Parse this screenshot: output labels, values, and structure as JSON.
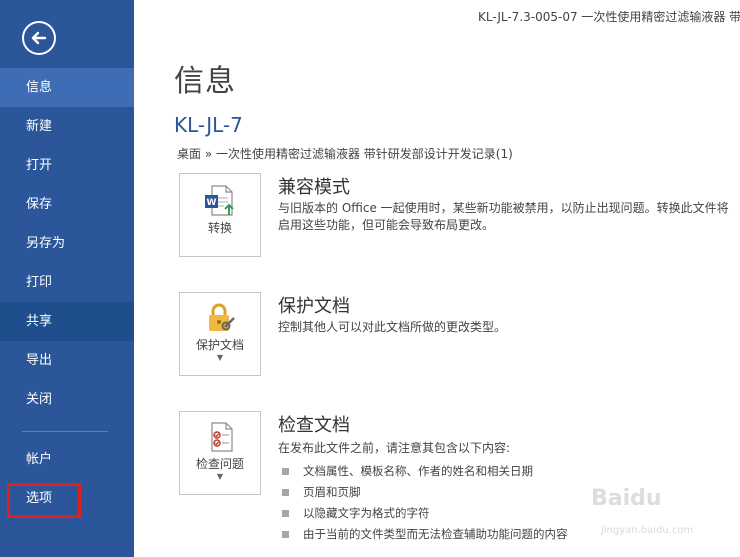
{
  "window": {
    "doc_title": "KL-JL-7.3-005-07 一次性使用精密过滤输液器 带钅"
  },
  "sidebar": {
    "items": [
      {
        "label": "信息"
      },
      {
        "label": "新建"
      },
      {
        "label": "打开"
      },
      {
        "label": "保存"
      },
      {
        "label": "另存为"
      },
      {
        "label": "打印"
      },
      {
        "label": "共享"
      },
      {
        "label": "导出"
      },
      {
        "label": "关闭"
      }
    ],
    "bottom_items": [
      {
        "label": "帐户"
      },
      {
        "label": "选项"
      }
    ]
  },
  "main": {
    "title": "信息",
    "doc_name": "KL-JL-7",
    "breadcrumb": "桌面 » 一次性使用精密过滤输液器 带针研发部设计开发记录(1)",
    "sections": [
      {
        "tile_label": "转换",
        "heading": "兼容模式",
        "desc": "与旧版本的 Office 一起使用时，某些新功能被禁用，以防止出现问题。转换此文件将启用这些功能，但可能会导致布局更改。"
      },
      {
        "tile_label": "保护文档",
        "heading": "保护文档",
        "desc": "控制其他人可以对此文档所做的更改类型。"
      },
      {
        "tile_label": "检查问题",
        "heading": "检查文档",
        "desc": "在发布此文件之前，请注意其包含以下内容:",
        "bullets": [
          "文档属性、模板名称、作者的姓名和相关日期",
          "页眉和页脚",
          "以隐藏文字为格式的字符",
          "由于当前的文件类型而无法检查辅助功能问题的内容"
        ]
      }
    ]
  },
  "watermark": {
    "text": "Baidu",
    "sub": "jingyan.baidu.com"
  },
  "colors": {
    "sidebar": "#2b579a",
    "selected": "#3e6db5",
    "highlight": "#e0201c",
    "accent": "#2b579a"
  }
}
